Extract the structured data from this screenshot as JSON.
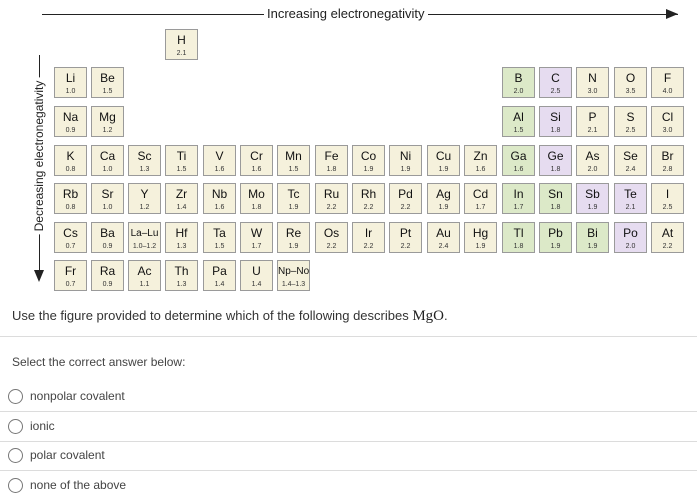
{
  "top_axis_label": "Increasing electronegativity",
  "side_axis_label": "Decreasing electronegativity",
  "elements": [
    {
      "s": "H",
      "v": "2.1",
      "c": 1,
      "r": 0,
      "t": "y"
    },
    {
      "s": "Li",
      "v": "1.0",
      "c": 1,
      "r": 1,
      "t": "y"
    },
    {
      "s": "Be",
      "v": "1.5",
      "c": 2,
      "r": 1,
      "t": "y"
    },
    {
      "s": "B",
      "v": "2.0",
      "c": 13,
      "r": 1,
      "t": "g"
    },
    {
      "s": "C",
      "v": "2.5",
      "c": 14,
      "r": 1,
      "t": "p"
    },
    {
      "s": "N",
      "v": "3.0",
      "c": 15,
      "r": 1,
      "t": "y"
    },
    {
      "s": "O",
      "v": "3.5",
      "c": 16,
      "r": 1,
      "t": "y"
    },
    {
      "s": "F",
      "v": "4.0",
      "c": 17,
      "r": 1,
      "t": "y"
    },
    {
      "s": "Na",
      "v": "0.9",
      "c": 0,
      "r": 2,
      "t": "y"
    },
    {
      "s": "Mg",
      "v": "1.2",
      "c": 1,
      "r": 2,
      "t": "y"
    },
    {
      "s": "Al",
      "v": "1.5",
      "c": 13,
      "r": 2,
      "t": "g"
    },
    {
      "s": "Si",
      "v": "1.8",
      "c": 14,
      "r": 2,
      "t": "p"
    },
    {
      "s": "P",
      "v": "2.1",
      "c": 15,
      "r": 2,
      "t": "y"
    },
    {
      "s": "S",
      "v": "2.5",
      "c": 16,
      "r": 2,
      "t": "y"
    },
    {
      "s": "Cl",
      "v": "3.0",
      "c": 17,
      "r": 2,
      "t": "y"
    },
    {
      "s": "K",
      "v": "0.8",
      "c": 0,
      "r": 3,
      "t": "y"
    },
    {
      "s": "Ca",
      "v": "1.0",
      "c": 1,
      "r": 3,
      "t": "y"
    },
    {
      "s": "Sc",
      "v": "1.3",
      "c": 2,
      "r": 3,
      "t": "y"
    },
    {
      "s": "Ti",
      "v": "1.5",
      "c": 3,
      "r": 3,
      "t": "y"
    },
    {
      "s": "V",
      "v": "1.6",
      "c": 4,
      "r": 3,
      "t": "y"
    },
    {
      "s": "Cr",
      "v": "1.6",
      "c": 5,
      "r": 3,
      "t": "y"
    },
    {
      "s": "Mn",
      "v": "1.5",
      "c": 6,
      "r": 3,
      "t": "y"
    },
    {
      "s": "Fe",
      "v": "1.8",
      "c": 7,
      "r": 3,
      "t": "y"
    },
    {
      "s": "Co",
      "v": "1.9",
      "c": 8,
      "r": 3,
      "t": "y"
    },
    {
      "s": "Ni",
      "v": "1.9",
      "c": 9,
      "r": 3,
      "t": "y"
    },
    {
      "s": "Cu",
      "v": "1.9",
      "c": 10,
      "r": 3,
      "t": "y"
    },
    {
      "s": "Zn",
      "v": "1.6",
      "c": 11,
      "r": 3,
      "t": "y"
    },
    {
      "s": "Ga",
      "v": "1.6",
      "c": 12,
      "r": 3,
      "t": "g"
    },
    {
      "s": "Ge",
      "v": "1.8",
      "c": 13,
      "r": 3,
      "t": "p"
    },
    {
      "s": "As",
      "v": "2.0",
      "c": 14,
      "r": 3,
      "t": "y"
    },
    {
      "s": "Se",
      "v": "2.4",
      "c": 15,
      "r": 3,
      "t": "y"
    },
    {
      "s": "Br",
      "v": "2.8",
      "c": 16,
      "r": 3,
      "t": "y"
    },
    {
      "s": "Rb",
      "v": "0.8",
      "c": 0,
      "r": 4,
      "t": "y"
    },
    {
      "s": "Sr",
      "v": "1.0",
      "c": 1,
      "r": 4,
      "t": "y"
    },
    {
      "s": "Y",
      "v": "1.2",
      "c": 2,
      "r": 4,
      "t": "y"
    },
    {
      "s": "Zr",
      "v": "1.4",
      "c": 3,
      "r": 4,
      "t": "y"
    },
    {
      "s": "Nb",
      "v": "1.6",
      "c": 4,
      "r": 4,
      "t": "y"
    },
    {
      "s": "Mo",
      "v": "1.8",
      "c": 5,
      "r": 4,
      "t": "y"
    },
    {
      "s": "Tc",
      "v": "1.9",
      "c": 6,
      "r": 4,
      "t": "y"
    },
    {
      "s": "Ru",
      "v": "2.2",
      "c": 7,
      "r": 4,
      "t": "y"
    },
    {
      "s": "Rh",
      "v": "2.2",
      "c": 8,
      "r": 4,
      "t": "y"
    },
    {
      "s": "Pd",
      "v": "2.2",
      "c": 9,
      "r": 4,
      "t": "y"
    },
    {
      "s": "Ag",
      "v": "1.9",
      "c": 10,
      "r": 4,
      "t": "y"
    },
    {
      "s": "Cd",
      "v": "1.7",
      "c": 11,
      "r": 4,
      "t": "y"
    },
    {
      "s": "In",
      "v": "1.7",
      "c": 12,
      "r": 4,
      "t": "g"
    },
    {
      "s": "Sn",
      "v": "1.8",
      "c": 13,
      "r": 4,
      "t": "g"
    },
    {
      "s": "Sb",
      "v": "1.9",
      "c": 14,
      "r": 4,
      "t": "p"
    },
    {
      "s": "Te",
      "v": "2.1",
      "c": 15,
      "r": 4,
      "t": "p"
    },
    {
      "s": "I",
      "v": "2.5",
      "c": 16,
      "r": 4,
      "t": "y"
    },
    {
      "s": "Cs",
      "v": "0.7",
      "c": 0,
      "r": 5,
      "t": "y"
    },
    {
      "s": "Ba",
      "v": "0.9",
      "c": 1,
      "r": 5,
      "t": "y"
    },
    {
      "s": "La–Lu",
      "v": "1.0–1.2",
      "c": 2,
      "r": 5,
      "t": "y",
      "sm": true
    },
    {
      "s": "Hf",
      "v": "1.3",
      "c": 3,
      "r": 5,
      "t": "y"
    },
    {
      "s": "Ta",
      "v": "1.5",
      "c": 4,
      "r": 5,
      "t": "y"
    },
    {
      "s": "W",
      "v": "1.7",
      "c": 5,
      "r": 5,
      "t": "y"
    },
    {
      "s": "Re",
      "v": "1.9",
      "c": 6,
      "r": 5,
      "t": "y"
    },
    {
      "s": "Os",
      "v": "2.2",
      "c": 7,
      "r": 5,
      "t": "y"
    },
    {
      "s": "Ir",
      "v": "2.2",
      "c": 8,
      "r": 5,
      "t": "y"
    },
    {
      "s": "Pt",
      "v": "2.2",
      "c": 9,
      "r": 5,
      "t": "y"
    },
    {
      "s": "Au",
      "v": "2.4",
      "c": 10,
      "r": 5,
      "t": "y"
    },
    {
      "s": "Hg",
      "v": "1.9",
      "c": 11,
      "r": 5,
      "t": "y"
    },
    {
      "s": "Tl",
      "v": "1.8",
      "c": 12,
      "r": 5,
      "t": "g"
    },
    {
      "s": "Pb",
      "v": "1.9",
      "c": 13,
      "r": 5,
      "t": "g"
    },
    {
      "s": "Bi",
      "v": "1.9",
      "c": 14,
      "r": 5,
      "t": "g"
    },
    {
      "s": "Po",
      "v": "2.0",
      "c": 15,
      "r": 5,
      "t": "p"
    },
    {
      "s": "At",
      "v": "2.2",
      "c": 16,
      "r": 5,
      "t": "y"
    },
    {
      "s": "Fr",
      "v": "0.7",
      "c": 0,
      "r": 6,
      "t": "y"
    },
    {
      "s": "Ra",
      "v": "0.9",
      "c": 1,
      "r": 6,
      "t": "y"
    },
    {
      "s": "Ac",
      "v": "1.1",
      "c": 2,
      "r": 6,
      "t": "y"
    },
    {
      "s": "Th",
      "v": "1.3",
      "c": 3,
      "r": 6,
      "t": "y"
    },
    {
      "s": "Pa",
      "v": "1.4",
      "c": 4,
      "r": 6,
      "t": "y"
    },
    {
      "s": "U",
      "v": "1.4",
      "c": 5,
      "r": 6,
      "t": "y"
    },
    {
      "s": "Np–No",
      "v": "1.4–1.3",
      "c": 6,
      "r": 6,
      "t": "y",
      "sm": true
    }
  ],
  "question": {
    "prefix": "Use the figure provided to determine which of the following describes ",
    "formula": "MgO",
    "suffix": "."
  },
  "select_label": "Select the correct answer below:",
  "options": [
    "nonpolar covalent",
    "ionic",
    "polar covalent",
    "none of the above"
  ],
  "colors": {
    "default_cell": "#f5f1dc",
    "green_cell": "#dce9c8",
    "purple_cell": "#e6dcf0"
  }
}
